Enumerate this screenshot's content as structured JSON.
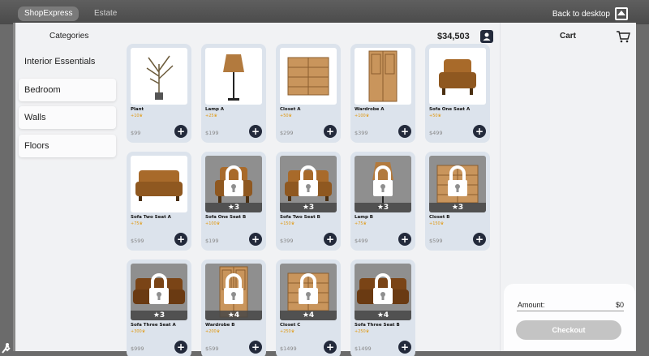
{
  "tabs": [
    {
      "label": "ShopExpress"
    },
    {
      "label": "Estate"
    }
  ],
  "back_to_desktop": "Back to desktop",
  "sidebar": {
    "title": "Categories",
    "items": [
      {
        "label": "Interior Essentials"
      },
      {
        "label": "Bedroom"
      },
      {
        "label": "Walls"
      },
      {
        "label": "Floors"
      }
    ]
  },
  "shop": {
    "balance": "$34,503",
    "products": [
      {
        "name": "Plant",
        "xp": "+10",
        "price": "$99",
        "locked": false,
        "icon": "plant"
      },
      {
        "name": "Lamp A",
        "xp": "+25",
        "price": "$199",
        "locked": false,
        "icon": "floor-lamp"
      },
      {
        "name": "Closet A",
        "xp": "+50",
        "price": "$299",
        "locked": false,
        "icon": "dresser"
      },
      {
        "name": "Wardrobe A",
        "xp": "+100",
        "price": "$399",
        "locked": false,
        "icon": "wardrobe"
      },
      {
        "name": "Sofa One Seat A",
        "xp": "+50",
        "price": "$499",
        "locked": false,
        "icon": "armchair"
      },
      {
        "name": "Sofa Two Seat A",
        "xp": "+75",
        "price": "$599",
        "locked": false,
        "icon": "loveseat"
      },
      {
        "name": "Sofa One Seat B",
        "xp": "+100",
        "price": "$199",
        "locked": true,
        "stars": "3",
        "icon": "armchair"
      },
      {
        "name": "Sofa Two Seat B",
        "xp": "+150",
        "price": "$399",
        "locked": true,
        "stars": "3",
        "icon": "loveseat"
      },
      {
        "name": "Lamp B",
        "xp": "+75",
        "price": "$499",
        "locked": true,
        "stars": "3",
        "icon": "floor-lamp"
      },
      {
        "name": "Closet B",
        "xp": "+150",
        "price": "$599",
        "locked": true,
        "stars": "3",
        "icon": "dresser"
      },
      {
        "name": "Sofa Three Seat A",
        "xp": "+300",
        "price": "$999",
        "locked": true,
        "stars": "3",
        "icon": "sofa"
      },
      {
        "name": "Wardrobe B",
        "xp": "+200",
        "price": "$599",
        "locked": true,
        "stars": "4",
        "icon": "wardrobe"
      },
      {
        "name": "Closet C",
        "xp": "+250",
        "price": "$1499",
        "locked": true,
        "stars": "4",
        "icon": "dresser"
      },
      {
        "name": "Sofa Three Seat B",
        "xp": "+250",
        "price": "$1499",
        "locked": true,
        "stars": "4",
        "icon": "sofa"
      }
    ]
  },
  "cart": {
    "title": "Cart",
    "amount_label": "Amount:",
    "amount_value": "$0",
    "checkout_label": "Checkout"
  },
  "colors": {
    "accent_dark": "#232a3b",
    "xp_gold": "#e09a14",
    "card_bg": "#dce3ec"
  }
}
